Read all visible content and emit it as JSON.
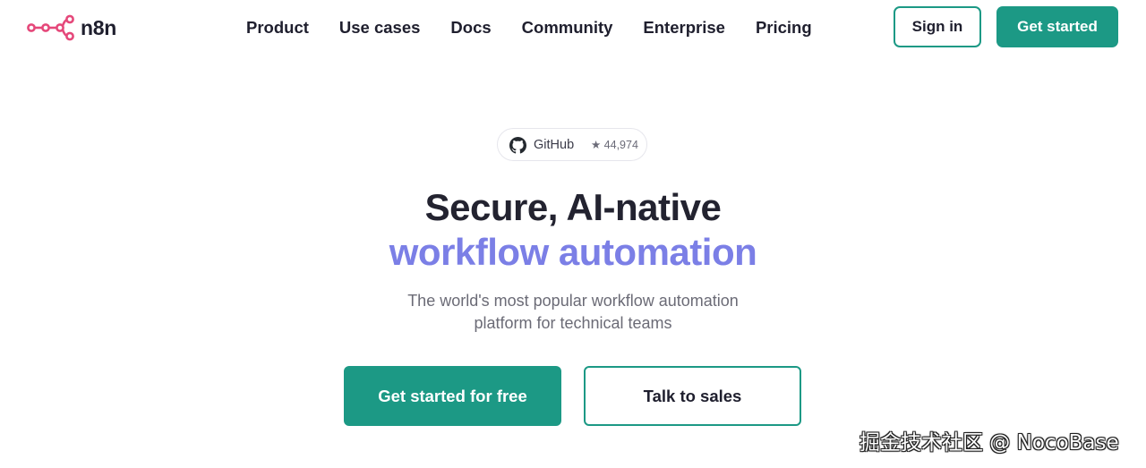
{
  "brand": {
    "name": "n8n",
    "logo_icon": "n8n-node-logo-icon",
    "logo_color": "#e5487a"
  },
  "nav": {
    "items": [
      {
        "label": "Product"
      },
      {
        "label": "Use cases"
      },
      {
        "label": "Docs"
      },
      {
        "label": "Community"
      },
      {
        "label": "Enterprise"
      },
      {
        "label": "Pricing"
      }
    ]
  },
  "header_actions": {
    "sign_in": "Sign in",
    "get_started": "Get started"
  },
  "github_badge": {
    "label": "GitHub",
    "icon": "github-icon",
    "stars": "★ 44,974"
  },
  "hero": {
    "title_line1": "Secure, AI-native",
    "title_line2": "workflow automation",
    "subtitle": "The world's most popular workflow automation platform for technical teams",
    "cta_primary": "Get started for free",
    "cta_secondary": "Talk to sales"
  },
  "watermark": {
    "text": "掘金技术社区 @ NocoBase"
  },
  "colors": {
    "accent_green": "#1c9985",
    "accent_purple": "#7b7fe6",
    "text_dark": "#1f1f2e",
    "text_muted": "#6b6b76"
  }
}
